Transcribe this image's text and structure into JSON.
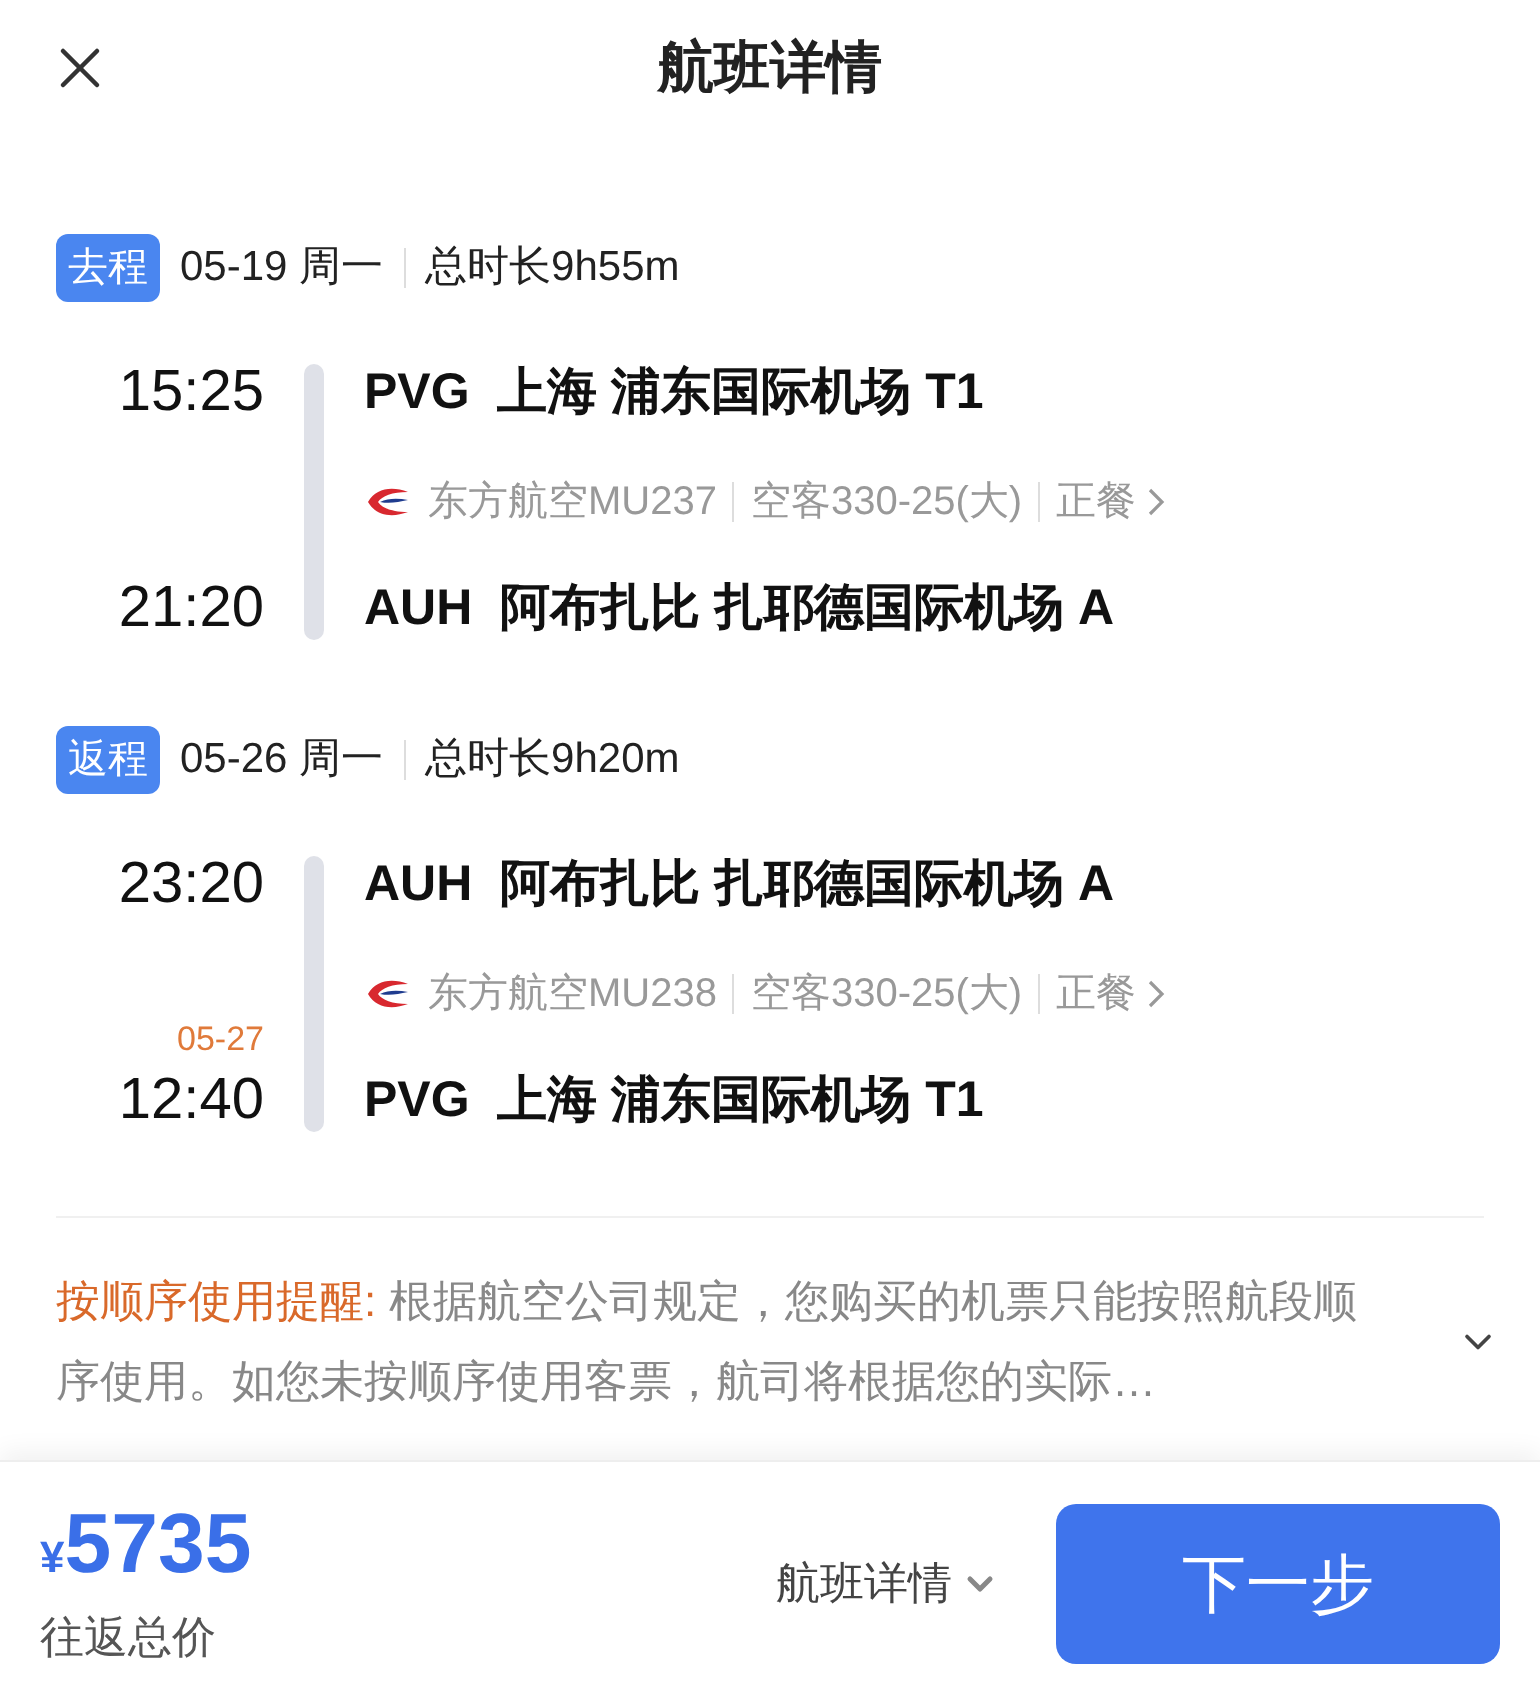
{
  "header": {
    "title": "航班详情"
  },
  "segments": [
    {
      "tag": "去程",
      "date": "05-19 周一",
      "duration": "总时长9h55m",
      "depart": {
        "time": "15:25",
        "code": "PVG",
        "airport": "上海 浦东国际机场 T1"
      },
      "flight": {
        "airline": "东方航空MU237",
        "aircraft": "空客330-25(大)",
        "meal": "正餐"
      },
      "arrive": {
        "time": "21:20",
        "code": "AUH",
        "airport": "阿布扎比 扎耶德国际机场 A"
      }
    },
    {
      "tag": "返程",
      "date": "05-26 周一",
      "duration": "总时长9h20m",
      "depart": {
        "time": "23:20",
        "code": "AUH",
        "airport": "阿布扎比 扎耶德国际机场 A"
      },
      "flight": {
        "airline": "东方航空MU238",
        "aircraft": "空客330-25(大)",
        "meal": "正餐"
      },
      "arrive": {
        "next_date": "05-27",
        "time": "12:40",
        "code": "PVG",
        "airport": "上海 浦东国际机场 T1"
      }
    }
  ],
  "notice": {
    "label": "按顺序使用提醒:",
    "text": "根据航空公司规定，您购买的机票只能按照航段顺序使用。如您未按顺序使用客票，航司将根据您的实际…",
    "expanded": false
  },
  "footer": {
    "currency": "¥",
    "price": "5735",
    "price_label": "往返总价",
    "details": "航班详情",
    "next": "下一步"
  }
}
